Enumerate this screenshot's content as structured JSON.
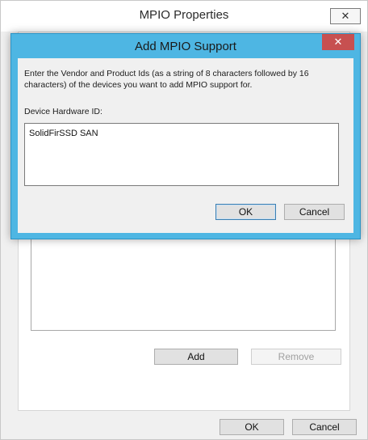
{
  "outer_window": {
    "title": "MPIO Properties",
    "close_glyph": "✕",
    "add_label": "Add",
    "remove_label": "Remove",
    "ok_label": "OK",
    "cancel_label": "Cancel"
  },
  "dialog": {
    "title": "Add MPIO Support",
    "close_glyph": "✕",
    "instructions": "Enter the Vendor and Product Ids (as a string of 8 characters followed by 16 characters) of the devices you want to add MPIO support for.",
    "field_label": "Device Hardware ID:",
    "field_value": "SolidFirSSD SAN",
    "ok_label": "OK",
    "cancel_label": "Cancel"
  },
  "colors": {
    "dialog_frame": "#4eb6e3",
    "dialog_close": "#c75050",
    "background": "#f0f0f0"
  }
}
